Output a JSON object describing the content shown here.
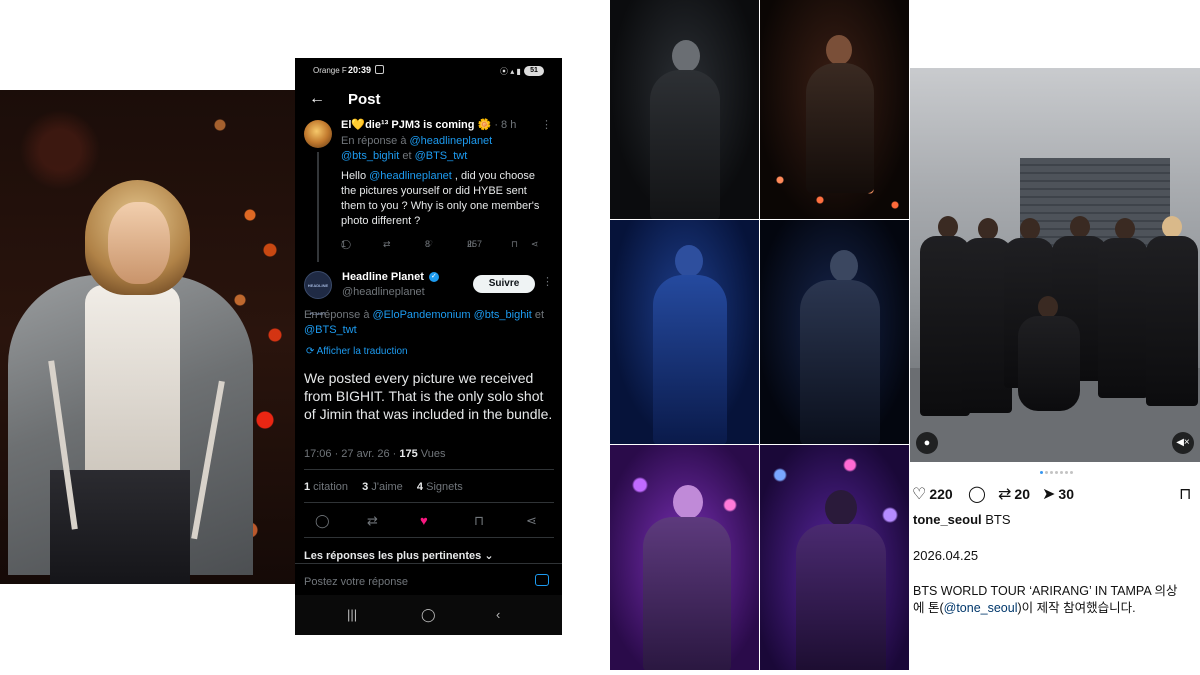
{
  "phone": {
    "status": {
      "carrier": "Orange F",
      "time": "20:39",
      "battery": "51"
    },
    "header": {
      "title": "Post"
    },
    "reply": {
      "author": "El💛die¹³ PJM3 is coming 🌼",
      "ago": "· 8 h",
      "in_reply_prefix": "En réponse à ",
      "in_reply_mention1": "@headlineplanet",
      "in_reply_mention2": "@bts_bighit",
      "in_reply_and": " et ",
      "in_reply_mention3": "@BTS_twt",
      "text_before": "Hello ",
      "text_mention": "@headlineplanet",
      "text_after": " , did you choose the pictures yourself or did HYBE sent them to you ? Why is only one member's photo different ?",
      "replies": "1",
      "likes": "8",
      "views": "257"
    },
    "post": {
      "author": "Headline Planet",
      "handle": "@headlineplanet",
      "avatar_text": "HEADLINE PLANET",
      "follow_label": "Suivre",
      "in_reply_prefix": "En réponse à ",
      "in_reply_mention1": "@EloPandemonium",
      "in_reply_mention2": "@bts_bighit",
      "in_reply_and": "et ",
      "in_reply_mention3": "@BTS_twt",
      "translate_label": "Afficher la traduction",
      "text": "We posted every picture we received from BIGHIT. That is the only solo shot of Jimin that was included in the bundle.",
      "timestamp": "17:06 · 27 avr. 26 · ",
      "views_count": "175",
      "views_label": " Vues",
      "quotes_count": "1",
      "quotes_label": " citation",
      "likes_count": "3",
      "likes_label": " J'aime",
      "bookmarks_count": "4",
      "bookmarks_label": " Signets"
    },
    "best_replies_label": "Les réponses les plus pertinentes",
    "compose_placeholder": "Postez votre réponse"
  },
  "instagram": {
    "likes": "220",
    "reposts": "20",
    "shares": "30",
    "username": "tone_seoul",
    "username_suffix": " BTS",
    "date": "2026.04.25",
    "caption_line1": "BTS WORLD TOUR ‘ARIRANG’ IN TAMPA 의상",
    "caption_line2_before": "에 톤(",
    "caption_mention": "@tone_seoul",
    "caption_line2_after": ")이 제작 참여했습니다."
  },
  "colors": {
    "twitter_link": "#1d9bf0",
    "twitter_bg": "#000000",
    "like_pink": "#f91880",
    "insta_dot_active": "#3897f0"
  }
}
